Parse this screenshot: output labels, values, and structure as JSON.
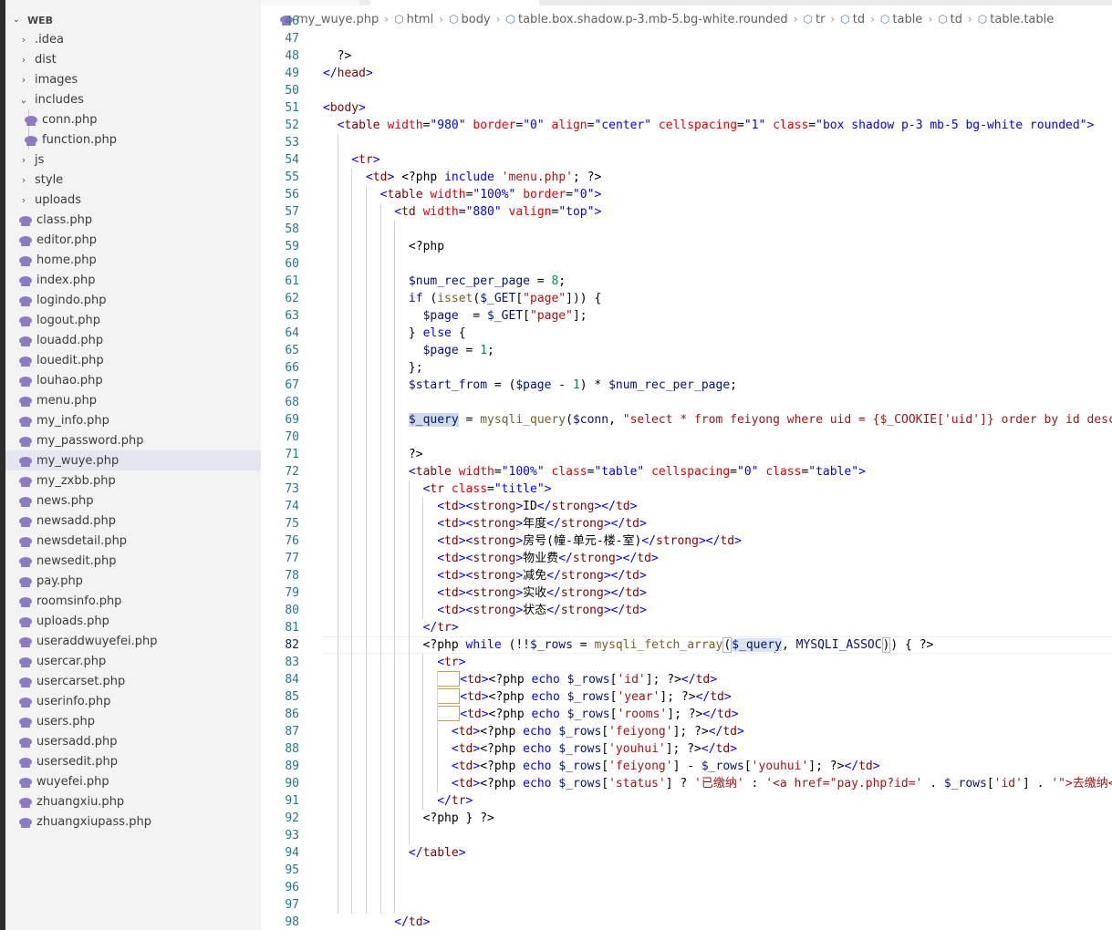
{
  "explorer": {
    "section_title": "WEB",
    "items": [
      {
        "label": ".idea",
        "type": "folder",
        "expanded": false,
        "depth": 1
      },
      {
        "label": "dist",
        "type": "folder",
        "expanded": false,
        "depth": 1
      },
      {
        "label": "images",
        "type": "folder",
        "expanded": false,
        "depth": 1
      },
      {
        "label": "includes",
        "type": "folder",
        "expanded": true,
        "depth": 1
      },
      {
        "label": "conn.php",
        "type": "file",
        "depth": 2
      },
      {
        "label": "function.php",
        "type": "file",
        "depth": 2
      },
      {
        "label": "js",
        "type": "folder",
        "expanded": false,
        "depth": 1
      },
      {
        "label": "style",
        "type": "folder",
        "expanded": false,
        "depth": 1
      },
      {
        "label": "uploads",
        "type": "folder",
        "expanded": false,
        "depth": 1
      },
      {
        "label": "class.php",
        "type": "file",
        "depth": 1
      },
      {
        "label": "editor.php",
        "type": "file",
        "depth": 1
      },
      {
        "label": "home.php",
        "type": "file",
        "depth": 1
      },
      {
        "label": "index.php",
        "type": "file",
        "depth": 1
      },
      {
        "label": "logindo.php",
        "type": "file",
        "depth": 1
      },
      {
        "label": "logout.php",
        "type": "file",
        "depth": 1
      },
      {
        "label": "louadd.php",
        "type": "file",
        "depth": 1
      },
      {
        "label": "louedit.php",
        "type": "file",
        "depth": 1
      },
      {
        "label": "louhao.php",
        "type": "file",
        "depth": 1
      },
      {
        "label": "menu.php",
        "type": "file",
        "depth": 1
      },
      {
        "label": "my_info.php",
        "type": "file",
        "depth": 1
      },
      {
        "label": "my_password.php",
        "type": "file",
        "depth": 1
      },
      {
        "label": "my_wuye.php",
        "type": "file",
        "depth": 1,
        "active": true
      },
      {
        "label": "my_zxbb.php",
        "type": "file",
        "depth": 1
      },
      {
        "label": "news.php",
        "type": "file",
        "depth": 1
      },
      {
        "label": "newsadd.php",
        "type": "file",
        "depth": 1
      },
      {
        "label": "newsdetail.php",
        "type": "file",
        "depth": 1
      },
      {
        "label": "newsedit.php",
        "type": "file",
        "depth": 1
      },
      {
        "label": "pay.php",
        "type": "file",
        "depth": 1
      },
      {
        "label": "roomsinfo.php",
        "type": "file",
        "depth": 1
      },
      {
        "label": "uploads.php",
        "type": "file",
        "depth": 1
      },
      {
        "label": "useraddwuyefei.php",
        "type": "file",
        "depth": 1
      },
      {
        "label": "usercar.php",
        "type": "file",
        "depth": 1
      },
      {
        "label": "usercarset.php",
        "type": "file",
        "depth": 1
      },
      {
        "label": "userinfo.php",
        "type": "file",
        "depth": 1
      },
      {
        "label": "users.php",
        "type": "file",
        "depth": 1
      },
      {
        "label": "usersadd.php",
        "type": "file",
        "depth": 1
      },
      {
        "label": "usersedit.php",
        "type": "file",
        "depth": 1
      },
      {
        "label": "wuyefei.php",
        "type": "file",
        "depth": 1
      },
      {
        "label": "zhuangxiu.php",
        "type": "file",
        "depth": 1
      },
      {
        "label": "zhuangxiupass.php",
        "type": "file",
        "depth": 1
      }
    ]
  },
  "breadcrumb": [
    {
      "label": "my_wuye.php",
      "icon": "php-file-icon"
    },
    {
      "label": "html",
      "icon": "cube-icon"
    },
    {
      "label": "body",
      "icon": "cube-icon"
    },
    {
      "label": "table.box.shadow.p-3.mb-5.bg-white.rounded",
      "icon": "cube-icon"
    },
    {
      "label": "tr",
      "icon": "cube-icon"
    },
    {
      "label": "td",
      "icon": "cube-icon"
    },
    {
      "label": "table",
      "icon": "cube-icon"
    },
    {
      "label": "td",
      "icon": "cube-icon"
    },
    {
      "label": "table.table",
      "icon": "cube-icon"
    }
  ],
  "editor": {
    "current_line": 82,
    "lines": [
      {
        "n": "46",
        "text": ""
      },
      {
        "n": "47",
        "text": ""
      },
      {
        "n": "48",
        "text": "  ?>"
      },
      {
        "n": "49",
        "text": "</head>"
      },
      {
        "n": "50",
        "text": ""
      },
      {
        "n": "51",
        "text": "<body>"
      },
      {
        "n": "52",
        "text": "  <table width=\"980\" border=\"0\" align=\"center\" cellspacing=\"1\" class=\"box shadow p-3 mb-5 bg-white rounded\">"
      },
      {
        "n": "53",
        "text": ""
      },
      {
        "n": "54",
        "text": "    <tr>"
      },
      {
        "n": "55",
        "text": "      <td> <?php include 'menu.php'; ?>"
      },
      {
        "n": "56",
        "text": "        <table width=\"100%\" border=\"0\">"
      },
      {
        "n": "57",
        "text": "          <td width=\"880\" valign=\"top\">"
      },
      {
        "n": "58",
        "text": ""
      },
      {
        "n": "59",
        "text": "            <?php"
      },
      {
        "n": "60",
        "text": ""
      },
      {
        "n": "61",
        "text": "            $num_rec_per_page = 8;"
      },
      {
        "n": "62",
        "text": "            if (isset($_GET[\"page\"])) {"
      },
      {
        "n": "63",
        "text": "              $page  = $_GET[\"page\"];"
      },
      {
        "n": "64",
        "text": "            } else {"
      },
      {
        "n": "65",
        "text": "              $page = 1;"
      },
      {
        "n": "66",
        "text": "            };"
      },
      {
        "n": "67",
        "text": "            $start_from = ($page - 1) * $num_rec_per_page;"
      },
      {
        "n": "68",
        "text": ""
      },
      {
        "n": "69",
        "text": "            $_query = mysqli_query($conn, \"select * from feiyong where uid = {$_COOKIE['uid']} order by id desc l"
      },
      {
        "n": "70",
        "text": ""
      },
      {
        "n": "71",
        "text": "            ?>"
      },
      {
        "n": "72",
        "text": "            <table width=\"100%\" class=\"table\" cellspacing=\"0\" class=\"table\">"
      },
      {
        "n": "73",
        "text": "              <tr class=\"title\">"
      },
      {
        "n": "74",
        "text": "                <td><strong>ID</strong></td>"
      },
      {
        "n": "75",
        "text": "                <td><strong>年度</strong></td>"
      },
      {
        "n": "76",
        "text": "                <td><strong>房号(幢-单元-楼-室)</strong></td>"
      },
      {
        "n": "77",
        "text": "                <td><strong>物业费</strong></td>"
      },
      {
        "n": "78",
        "text": "                <td><strong>减免</strong></td>"
      },
      {
        "n": "79",
        "text": "                <td><strong>实收</strong></td>"
      },
      {
        "n": "80",
        "text": "                <td><strong>状态</strong></td>"
      },
      {
        "n": "81",
        "text": "              </tr>"
      },
      {
        "n": "82",
        "text": "              <?php while (!!$_rows = mysqli_fetch_array($_query, MYSQLI_ASSOC)) { ?>"
      },
      {
        "n": "83",
        "text": "                <tr>"
      },
      {
        "n": "84",
        "text": "                  <td><?php echo $_rows['id']; ?></td>"
      },
      {
        "n": "85",
        "text": "                  <td><?php echo $_rows['year']; ?></td>"
      },
      {
        "n": "86",
        "text": "                  <td><?php echo $_rows['rooms']; ?></td>"
      },
      {
        "n": "87",
        "text": "                  <td><?php echo $_rows['feiyong']; ?></td>"
      },
      {
        "n": "88",
        "text": "                  <td><?php echo $_rows['youhui']; ?></td>"
      },
      {
        "n": "89",
        "text": "                  <td><?php echo $_rows['feiyong'] - $_rows['youhui']; ?></td>"
      },
      {
        "n": "90",
        "text": "                  <td><?php echo $_rows['status'] ? '已缴纳' : '<a href=\"pay.php?id=' . $_rows['id'] . '\">去缴纳</"
      },
      {
        "n": "91",
        "text": "                </tr>"
      },
      {
        "n": "92",
        "text": "              <?php } ?>"
      },
      {
        "n": "93",
        "text": ""
      },
      {
        "n": "94",
        "text": "            </table>"
      },
      {
        "n": "95",
        "text": ""
      },
      {
        "n": "96",
        "text": ""
      },
      {
        "n": "97",
        "text": ""
      },
      {
        "n": "98",
        "text": "          </td>"
      }
    ]
  }
}
